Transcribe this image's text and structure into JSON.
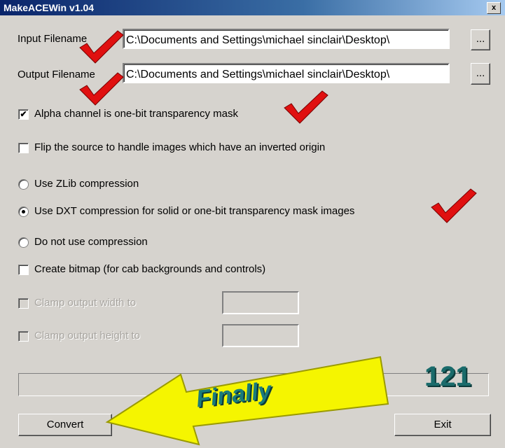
{
  "window": {
    "title": "MakeACEWin v1.04",
    "close_label": "x"
  },
  "input": {
    "label": "Input Filename",
    "value": "C:\\Documents and Settings\\michael sinclair\\Desktop\\",
    "browse_label": "..."
  },
  "output": {
    "label": "Output Filename",
    "value": "C:\\Documents and Settings\\michael sinclair\\Desktop\\",
    "browse_label": "..."
  },
  "options": {
    "alpha_label": "Alpha channel is one-bit transparency mask",
    "alpha_checked": true,
    "flip_label": "Flip the source to handle images which have an inverted origin",
    "flip_checked": false
  },
  "compression": {
    "zlib_label": "Use ZLib compression",
    "dxt_label": "Use DXT compression for solid or one-bit transparency mask images",
    "none_label": "Do not use compression",
    "selected": "dxt"
  },
  "bitmap": {
    "label": "Create bitmap (for cab backgrounds and controls)",
    "checked": false
  },
  "clamp": {
    "width_label": "Clamp output width to",
    "height_label": "Clamp output height to",
    "width_value": "",
    "height_value": ""
  },
  "progress": {
    "percent": 0
  },
  "annotation": {
    "counter": "121",
    "callout": "Finally"
  },
  "buttons": {
    "convert": "Convert",
    "exit": "Exit"
  },
  "colors": {
    "check_red": "#e01010",
    "arrow_yellow": "#f5f500",
    "callout_teal": "#1a7b7b"
  }
}
